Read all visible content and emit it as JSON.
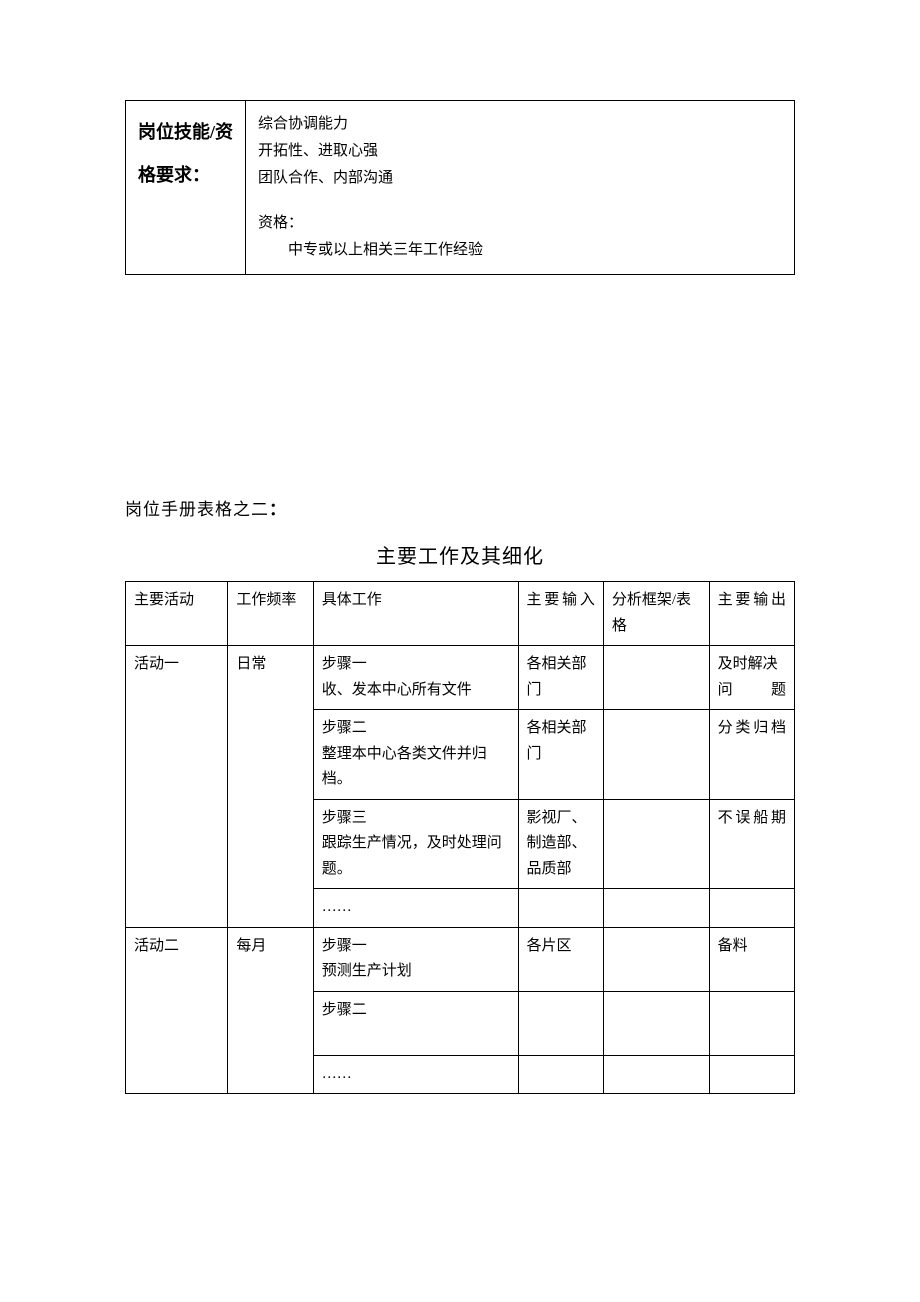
{
  "skills_box": {
    "label": "岗位技能/资格要求：",
    "skills": [
      "综合协调能力",
      "开拓性、进取心强",
      "团队合作、内部沟通"
    ],
    "qualification_label": "资格：",
    "qualification_detail": "中专或以上相关三年工作经验"
  },
  "section2": {
    "heading": "岗位手册表格之二",
    "colon": "：",
    "title": "主要工作及其细化"
  },
  "work_table": {
    "headers": {
      "activity": "主要活动",
      "frequency": "工作频率",
      "detail": "具体工作",
      "input": "主要输入",
      "framework": "分析框架/表格",
      "output": "主要输出"
    },
    "rows": [
      {
        "activity": "活动一",
        "frequency": "日常",
        "detail_step": "步骤一",
        "detail_body": "收、发本中心所有文件",
        "input": "各相关部门",
        "framework": "",
        "output": "及时解决问题"
      },
      {
        "activity": "",
        "frequency": "",
        "detail_step": "步骤二",
        "detail_body": "整理本中心各类文件并归档。",
        "input": "各相关部门",
        "framework": "",
        "output": "分类归档"
      },
      {
        "activity": "",
        "frequency": "",
        "detail_step": "步骤三",
        "detail_body": "跟踪生产情况，及时处理问题。",
        "input": "影视厂、制造部、品质部",
        "framework": "",
        "output": "不误船期"
      },
      {
        "activity": "",
        "frequency": "",
        "detail_step": "……",
        "detail_body": "",
        "input": "",
        "framework": "",
        "output": ""
      },
      {
        "activity": "活动二",
        "frequency": "每月",
        "detail_step": "步骤一",
        "detail_body": "预测生产计划",
        "input": "各片区",
        "framework": "",
        "output": "备料"
      },
      {
        "activity": "",
        "frequency": "",
        "detail_step": "步骤二",
        "detail_body": " ",
        "input": "",
        "framework": "",
        "output": ""
      },
      {
        "activity": "",
        "frequency": "",
        "detail_step": "……",
        "detail_body": "",
        "input": "",
        "framework": "",
        "output": ""
      }
    ]
  }
}
